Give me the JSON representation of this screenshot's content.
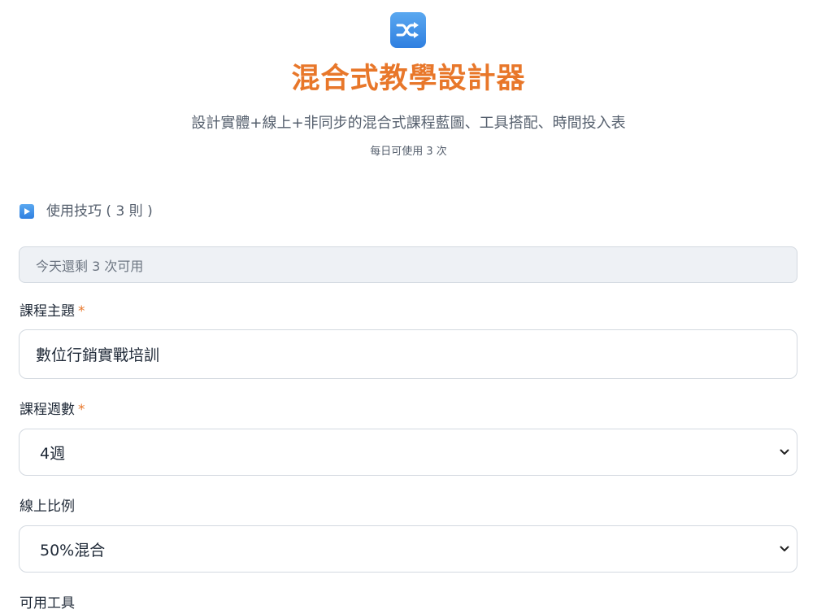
{
  "header": {
    "icon": "shuffle-icon",
    "icon_color": "#2f7fe0",
    "title": "混合式教學設計器",
    "title_color": "#e8772a",
    "subtitle": "設計實體+線上+非同步的混合式課程藍圖、工具搭配、時間投入表",
    "usage_limit": "每日可使用 3 次"
  },
  "tips": {
    "icon": "play-icon",
    "label": "使用技巧 ( 3 則 )"
  },
  "remaining": {
    "text": "今天還剩 3 次可用"
  },
  "form": {
    "topic": {
      "label": "課程主題",
      "required_mark": "*",
      "value": "數位行銷實戰培訓"
    },
    "weeks": {
      "label": "課程週數",
      "required_mark": "*",
      "selected": "4週"
    },
    "online_ratio": {
      "label": "線上比例",
      "selected": "50%混合"
    },
    "tools": {
      "label": "可用工具"
    }
  }
}
